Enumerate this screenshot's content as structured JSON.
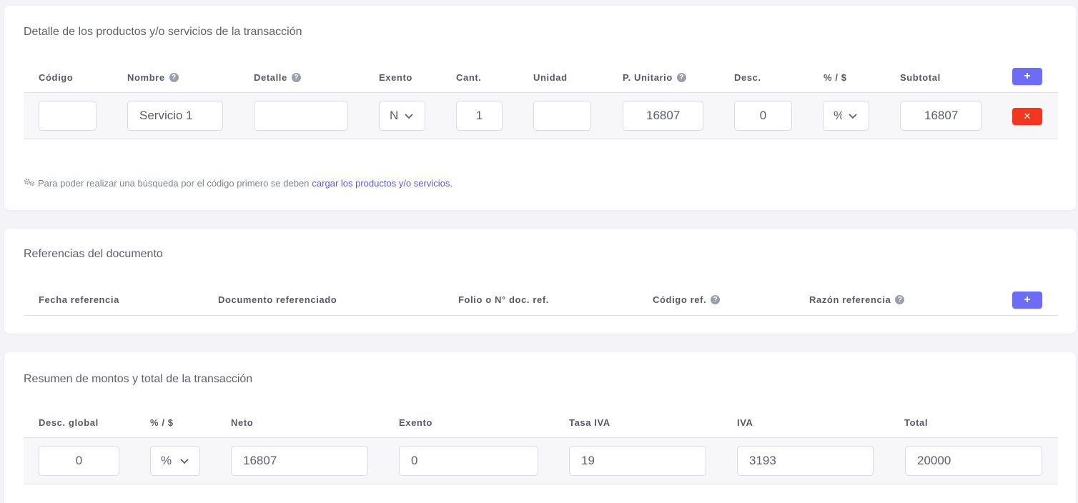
{
  "products": {
    "title": "Detalle de los productos y/o servicios de la transacción",
    "headers": {
      "codigo": "Código",
      "nombre": "Nombre",
      "detalle": "Detalle",
      "exento": "Exento",
      "cant": "Cant.",
      "unidad": "Unidad",
      "p_unitario": "P. Unitario",
      "desc": "Desc.",
      "pct": "% / $",
      "subtotal": "Subtotal"
    },
    "add_label": "+",
    "row": {
      "codigo": "",
      "nombre": "Servicio 1",
      "detalle": "",
      "exento": "N",
      "cant": "1",
      "unidad": "",
      "p_unitario": "16807",
      "desc": "0",
      "pct": "%",
      "subtotal": "16807",
      "delete_label": "✕"
    },
    "note_text": "Para poder realizar una búsqueda por el código primero se deben",
    "note_link": "cargar los productos y/o servicios."
  },
  "references": {
    "title": "Referencias del documento",
    "headers": {
      "fecha": "Fecha referencia",
      "documento": "Documento referenciado",
      "folio": "Folio o N° doc. ref.",
      "codigo": "Código ref.",
      "razon": "Razón referencia"
    },
    "add_label": "+"
  },
  "summary": {
    "title": "Resumen de montos y total de la transacción",
    "headers": {
      "desc_global": "Desc. global",
      "pct": "% / $",
      "neto": "Neto",
      "exento": "Exento",
      "tasa_iva": "Tasa IVA",
      "iva": "IVA",
      "total": "Total"
    },
    "values": {
      "desc_global": "0",
      "pct": "%",
      "neto": "16807",
      "exento": "0",
      "tasa_iva": "19",
      "iva": "3193",
      "total": "20000"
    }
  },
  "icons": {
    "help": "question-circle-icon",
    "gear": "gears-icon",
    "chevron": "chevron-down-icon"
  },
  "colors": {
    "accent": "#6c6cf5",
    "danger": "#f2361f",
    "link": "#5b5bd6"
  }
}
